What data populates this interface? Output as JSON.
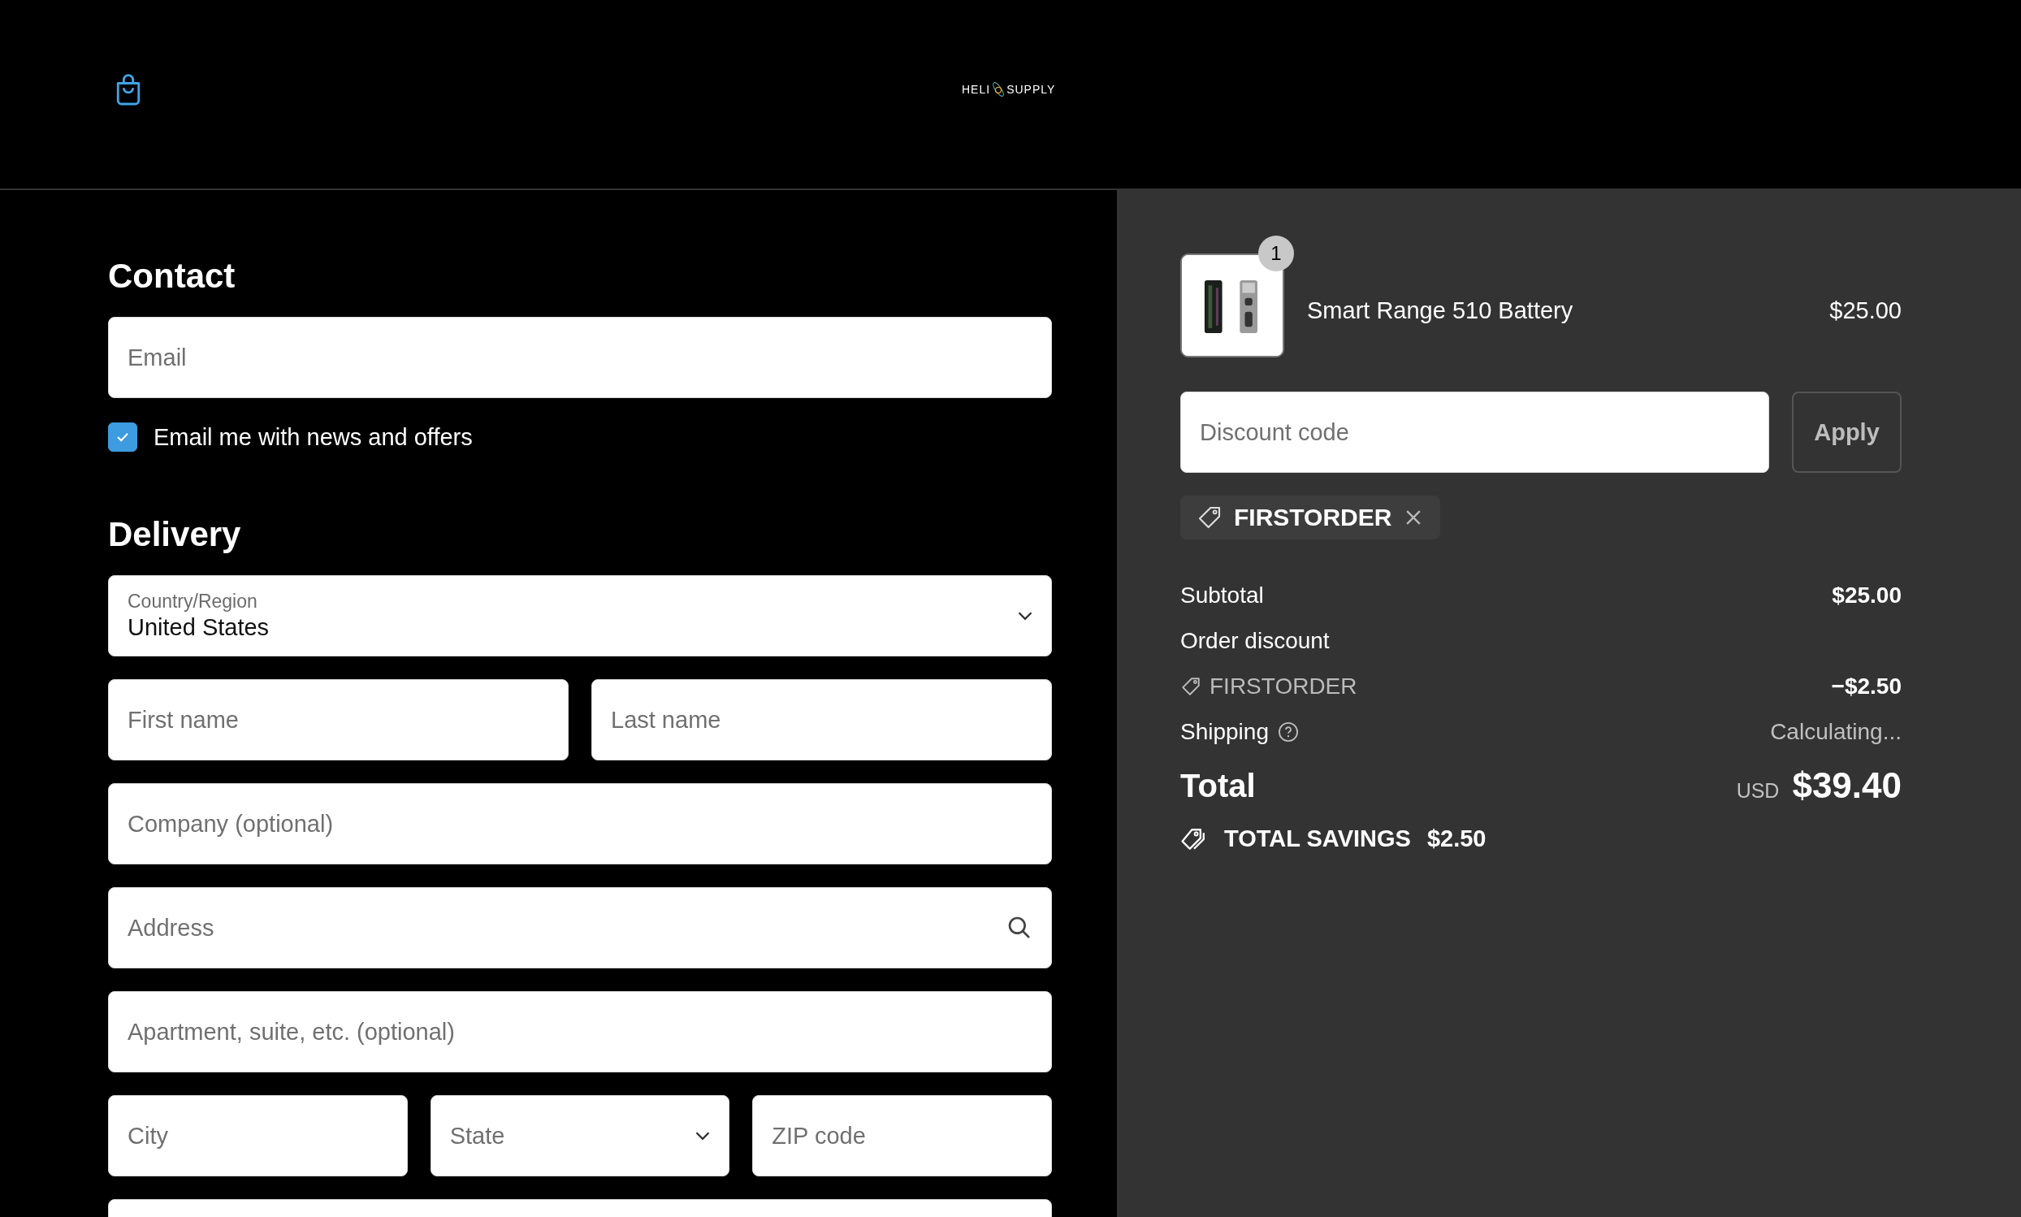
{
  "header": {
    "logo": {
      "left": "HELI",
      "right": "SUPPLY"
    }
  },
  "contact": {
    "title": "Contact",
    "email": {
      "placeholder": "Email"
    },
    "newsletter": {
      "label": "Email me with news and offers",
      "checked": true
    }
  },
  "delivery": {
    "title": "Delivery",
    "rows": [
      {
        "fields": [
          {
            "kind": "select",
            "label": "Country/Region",
            "value": "United States"
          }
        ]
      },
      {
        "fields": [
          {
            "kind": "text",
            "placeholder": "First name"
          },
          {
            "kind": "text",
            "placeholder": "Last name"
          }
        ]
      },
      {
        "fields": [
          {
            "kind": "text",
            "placeholder": "Company (optional)"
          }
        ]
      },
      {
        "fields": [
          {
            "kind": "search",
            "placeholder": "Address"
          }
        ]
      },
      {
        "fields": [
          {
            "kind": "text",
            "placeholder": "Apartment, suite, etc. (optional)"
          }
        ]
      },
      {
        "fields": [
          {
            "kind": "text",
            "placeholder": "City"
          },
          {
            "kind": "select",
            "placeholder": "State"
          },
          {
            "kind": "text",
            "placeholder": "ZIP code"
          }
        ]
      },
      {
        "fields": [
          {
            "kind": "text"
          }
        ]
      }
    ]
  },
  "summary": {
    "item": {
      "quantity": "1",
      "name": "Smart Range 510 Battery",
      "price": "$25.00"
    },
    "discount": {
      "placeholder": "Discount code",
      "button": "Apply",
      "applied_code": "FIRSTORDER"
    },
    "lines": [
      {
        "kind": "plain",
        "label": "Subtotal",
        "value": "$25.00"
      },
      {
        "kind": "heading",
        "label": "Order discount"
      },
      {
        "kind": "code",
        "label": "FIRSTORDER",
        "value": "−$2.50"
      },
      {
        "kind": "help",
        "label": "Shipping",
        "value": "Calculating..."
      }
    ],
    "total": {
      "label": "Total",
      "currency": "USD",
      "value": "$39.40"
    },
    "savings": {
      "label": "TOTAL SAVINGS",
      "value": "$2.50"
    }
  }
}
